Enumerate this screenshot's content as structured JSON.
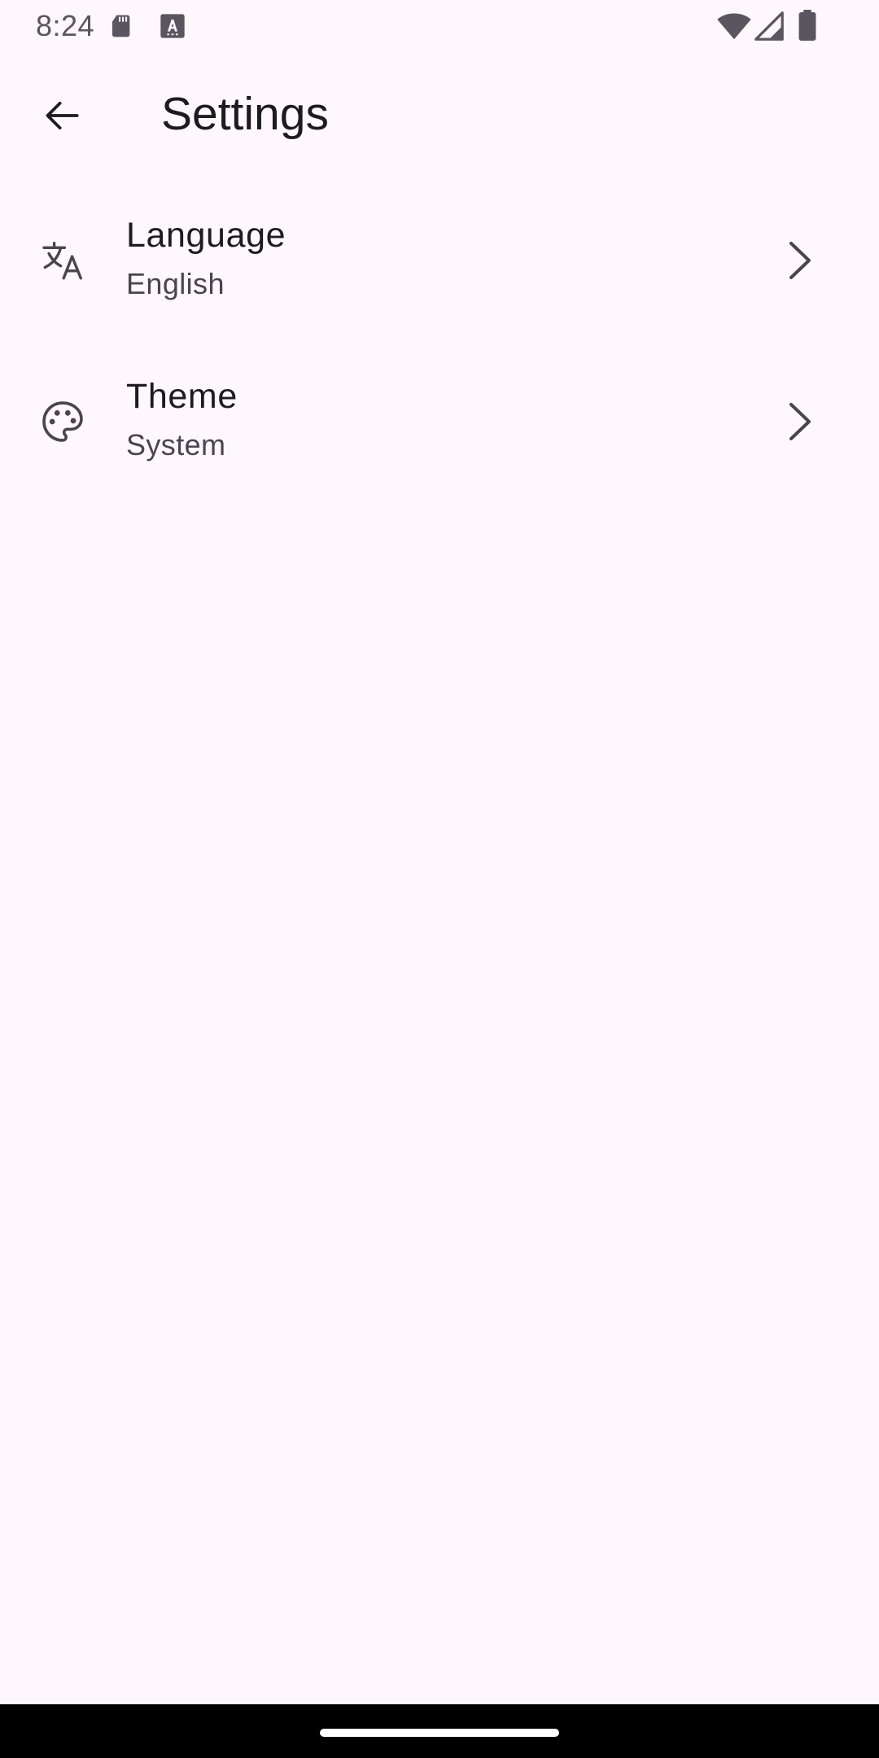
{
  "status_bar": {
    "time": "8:24",
    "icons": [
      "sd-card-icon",
      "a-icon",
      "wifi-icon",
      "signal-icon",
      "battery-icon"
    ]
  },
  "top_bar": {
    "title": "Settings",
    "back_icon": "arrow-back-icon"
  },
  "settings": [
    {
      "title": "Language",
      "value": "English",
      "icon": "translate-icon"
    },
    {
      "title": "Theme",
      "value": "System",
      "icon": "palette-icon"
    }
  ],
  "colors": {
    "background": "#FEF7FC",
    "primary_text": "#1D1B20",
    "secondary_text": "#49454F",
    "icon": "#49454F",
    "nav_bar": "#000000"
  }
}
